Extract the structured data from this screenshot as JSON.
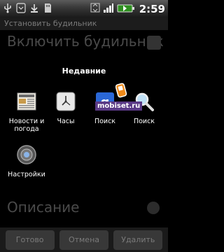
{
  "status_bar": {
    "time": "2:59",
    "icons": [
      "usb-icon",
      "debug-icon",
      "download-icon",
      "sd-card-icon",
      "network-icon",
      "signal-icon",
      "battery-icon",
      "time-icon"
    ]
  },
  "background": {
    "title": "Установить будильник",
    "row1_label": "Включить будильник",
    "row2_label": "Описание",
    "buttons": {
      "done": "Готово",
      "revert": "Отмена",
      "delete": "Удалить"
    }
  },
  "dialog": {
    "title": "Недавние",
    "apps": [
      {
        "label": "Новости и погода",
        "icon": "news-weather-icon"
      },
      {
        "label": "Часы",
        "icon": "clock-icon"
      },
      {
        "label": "Поиск",
        "icon": "google-search-icon"
      },
      {
        "label": "Поиск",
        "icon": "search-magnifier-icon"
      },
      {
        "label": "Настройки",
        "icon": "settings-icon"
      }
    ]
  },
  "watermark": {
    "text": "mobiset.ru"
  }
}
